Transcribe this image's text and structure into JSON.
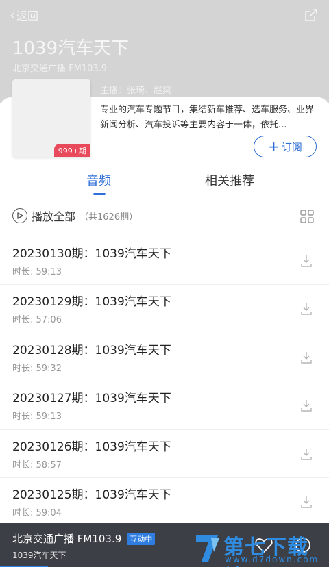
{
  "header": {
    "back_label": "返回",
    "title": "1039汽车天下",
    "subtitle": "北京交通广播 FM103.9",
    "host": "主播：张琦、赵爽"
  },
  "album": {
    "badge": "999+期",
    "description": "专业的汽车专题节目，集结新车推荐、选车服务、业界新闻分析、汽车投诉等主要内容于一体，依托...",
    "subscribe_plus": "+",
    "subscribe_label": "订阅"
  },
  "tabs": [
    {
      "label": "音频",
      "active": true
    },
    {
      "label": "相关推荐",
      "active": false
    }
  ],
  "playall": {
    "label": "播放全部",
    "count": "（共1626期）"
  },
  "episodes": [
    {
      "title": "20230130期：1039汽车天下",
      "duration": "时长: 59:13"
    },
    {
      "title": "20230129期：1039汽车天下",
      "duration": "时长: 57:06"
    },
    {
      "title": "20230128期：1039汽车天下",
      "duration": "时长: 59:32"
    },
    {
      "title": "20230127期：1039汽车天下",
      "duration": "时长: 59:13"
    },
    {
      "title": "20230126期：1039汽车天下",
      "duration": "时长: 58:57"
    },
    {
      "title": "20230125期：1039汽车天下",
      "duration": "时长: 59:04"
    }
  ],
  "player": {
    "station": "北京交通广播 FM103.9",
    "live_badge": "互动中",
    "program": "1039汽车天下"
  },
  "watermark": {
    "text": "第七下载站",
    "url": "www.d7down.com"
  },
  "icons": {
    "back": "chevron-left-icon",
    "share": "share-icon",
    "play": "play-circle-icon",
    "grid": "grid-icon",
    "download": "download-icon",
    "heart": "heart-icon"
  },
  "colors": {
    "accent": "#2f6fd8",
    "badge": "#e84a5b",
    "header_bg": "#d4d4d4",
    "player_bg": "#3c3f46"
  }
}
